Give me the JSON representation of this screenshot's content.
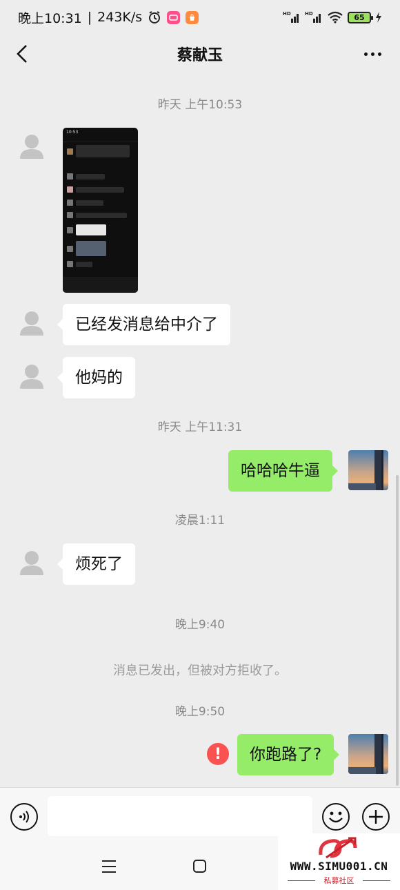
{
  "status_bar": {
    "time": "晚上10:31",
    "speed": "243K/s",
    "net1": "HD",
    "net2": "HD",
    "battery": "65"
  },
  "header": {
    "title": "蔡献玉"
  },
  "messages": [
    {
      "type": "timestamp",
      "text": "昨天 上午10:53"
    },
    {
      "type": "image",
      "from": "contact"
    },
    {
      "type": "text",
      "from": "contact",
      "text": "已经发消息给中介了"
    },
    {
      "type": "text",
      "from": "contact",
      "text": "他妈的"
    },
    {
      "type": "timestamp",
      "text": "昨天 上午11:31"
    },
    {
      "type": "text",
      "from": "me",
      "text": "哈哈哈牛逼"
    },
    {
      "type": "timestamp",
      "text": "凌晨1:11"
    },
    {
      "type": "text",
      "from": "contact",
      "text": "烦死了"
    },
    {
      "type": "timestamp",
      "text": "晚上9:40"
    },
    {
      "type": "system",
      "text": "消息已发出，但被对方拒收了。"
    },
    {
      "type": "timestamp",
      "text": "晚上9:50"
    },
    {
      "type": "text",
      "from": "me",
      "text": "你跑路了?",
      "failed": true
    }
  ],
  "image_thumb": {
    "time": "10:53"
  },
  "input_bar": {
    "text": ""
  },
  "watermark": {
    "url": "WWW.SIMU001.CN",
    "sub": "私募社区"
  },
  "colors": {
    "background": "#ededed",
    "bubble_self": "#95ec69",
    "bubble_other": "#ffffff",
    "error": "#fa5151"
  }
}
